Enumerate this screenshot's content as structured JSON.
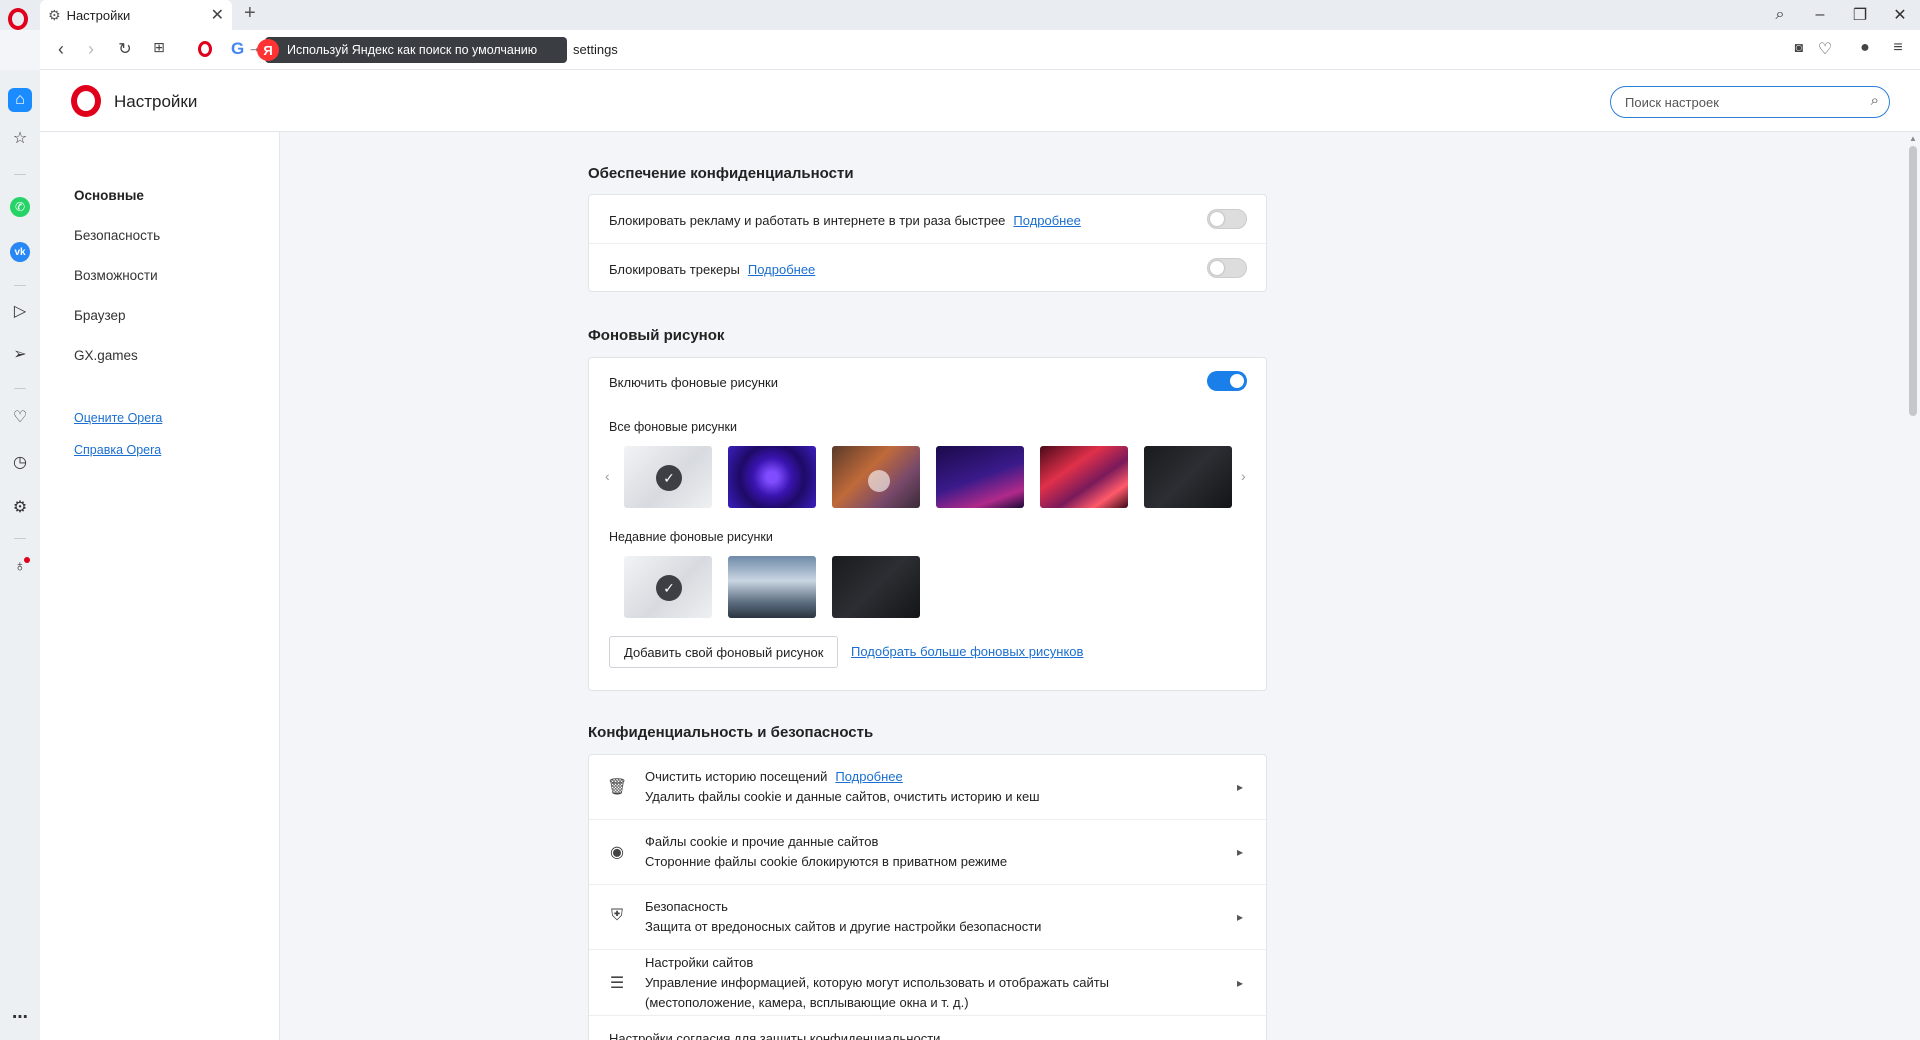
{
  "tab": {
    "title": "Настройки"
  },
  "addressbar": {
    "yandex_prompt": "Используй Яндекс как поиск по умолчанию",
    "url": "settings"
  },
  "header": {
    "title": "Настройки",
    "search_placeholder": "Поиск настроек"
  },
  "nav": {
    "items": [
      "Основные",
      "Безопасность",
      "Возможности",
      "Браузер",
      "GX.games"
    ],
    "links": [
      "Оцените Opera",
      "Справка Opera"
    ]
  },
  "privacy": {
    "title": "Обеспечение конфиденциальности",
    "rows": [
      {
        "label": "Блокировать рекламу и работать в интернете в три раза быстрее",
        "link": "Подробнее",
        "enabled": false
      },
      {
        "label": "Блокировать трекеры",
        "link": "Подробнее",
        "enabled": false
      }
    ]
  },
  "wallpapers": {
    "title": "Фоновый рисунок",
    "enable_label": "Включить фоновые рисунки",
    "enabled": true,
    "all_label": "Все фоновые рисунки",
    "recent_label": "Недавние фоновые рисунки",
    "add_button": "Добавить свой фоновый рисунок",
    "more_link": "Подобрать больше фоновых рисунков"
  },
  "privacy_security": {
    "title": "Конфиденциальность и безопасность",
    "items": [
      {
        "title": "Очистить историю посещений",
        "link": "Подробнее",
        "subtitle": "Удалить файлы cookie и данные сайтов, очистить историю и кеш"
      },
      {
        "title": "Файлы cookie и прочие данные сайтов",
        "subtitle": "Сторонние файлы cookie блокируются в приватном режиме"
      },
      {
        "title": "Безопасность",
        "subtitle": "Защита от вредоносных сайтов и другие настройки безопасности"
      },
      {
        "title": "Настройки сайтов",
        "subtitle": "Управление информацией, которую могут использовать и отображать сайты",
        "subtitle2": "(местоположение, камера, всплывающие окна и т. д.)"
      },
      {
        "title": "Настройки согласия для защиты конфиденциальности"
      }
    ]
  },
  "colors": {
    "accent": "#1a7fe8",
    "opera_red": "#e0001b"
  }
}
